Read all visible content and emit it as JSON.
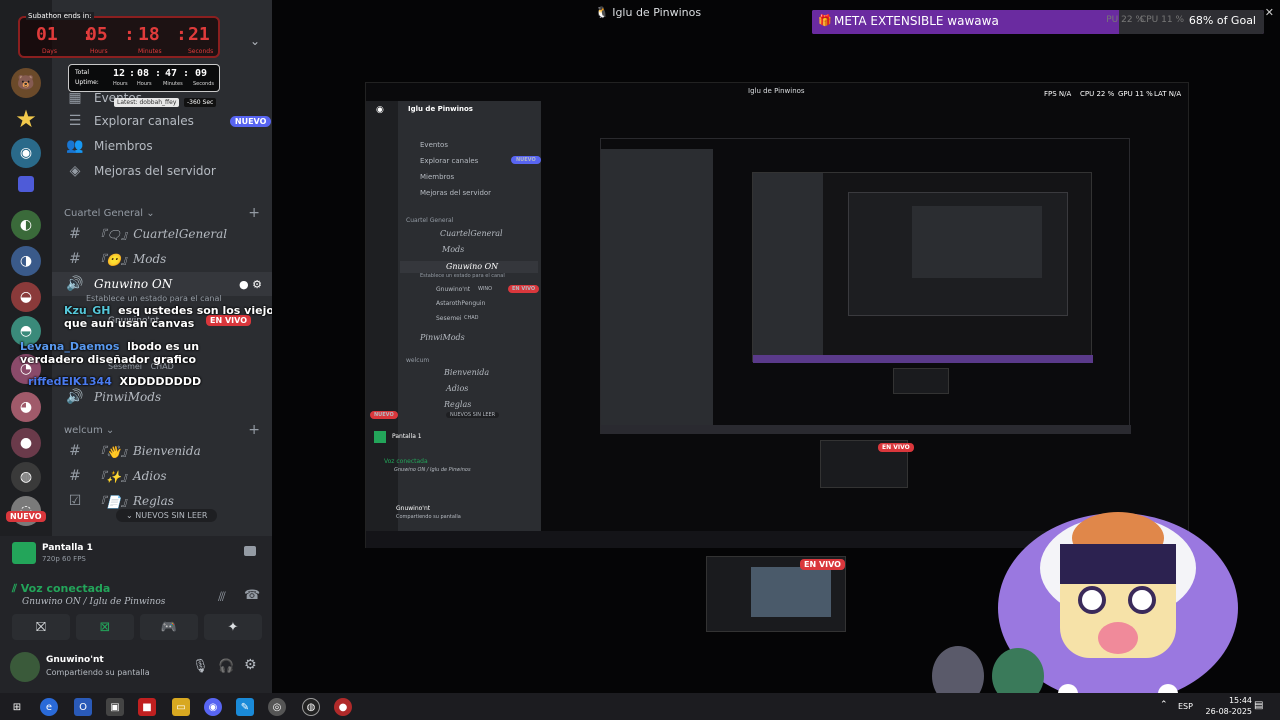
{
  "subathon": {
    "title": "Subathon ends in:",
    "days": "01",
    "hours": "05",
    "minutes": "18",
    "seconds": "21",
    "labels": [
      "Days",
      "Hours",
      "Minutes",
      "Seconds"
    ]
  },
  "uptime": {
    "total_label": "Total",
    "uptime_label": "Uptime:",
    "hours": "12",
    "minutes": "08",
    "seconds": "47",
    "extra": "09",
    "labels": [
      "Hours",
      "Hours",
      "Minutes",
      "Seconds"
    ],
    "latest": "Latest: dobbah_ffey",
    "latest_value": "-360 Sec"
  },
  "sidebar": {
    "events": "Eventos",
    "explore": "Explorar canales",
    "explore_badge": "NUEVO",
    "members": "Miembros",
    "server_improvements": "Mejoras del servidor",
    "category_general": "Cuartel General",
    "channels": [
      {
        "prefix": "『🗨』",
        "name": "CuartelGeneral"
      },
      {
        "prefix": "『😶』",
        "name": "Mods"
      }
    ],
    "voice_channel": {
      "name": "Gnuwino ON",
      "status": "Establece un estado para el canal"
    },
    "voice_users": [
      {
        "name": "Gnuwino'nt",
        "badge": "EN VIVO"
      },
      {
        "name": "Sesemei",
        "badge": "CHAD"
      }
    ],
    "voice_pinwi": "PinwiMods",
    "category_welcome": "welcum",
    "welcome_channels": [
      {
        "prefix": "『👋』",
        "name": "Bienvenida"
      },
      {
        "prefix": "『✨』",
        "name": "Adios"
      },
      {
        "prefix": "『📄』",
        "name": "Reglas"
      }
    ],
    "unread_pill": "NUEVOS SIN LEER",
    "nuevo_badge": "NUEVO"
  },
  "chat": [
    {
      "user": "Kzu_GH",
      "text": "esq ustedes son los viejos que aun usan canvas"
    },
    {
      "user": "Levana_Daemos",
      "text": "lbodo es un verdadero diseñador grafico"
    },
    {
      "user": "riffedElK1344",
      "text": "XDDDDDDDD"
    }
  ],
  "stream_panel": {
    "screen_name": "Pantalla 1",
    "screen_info": "720p 60 FPS",
    "voice_connected": "Voz conectada",
    "voice_location": "Gnuwino ON / Iglu de Pinwinos",
    "user_name": "Gnuwino'nt",
    "user_status": "Compartiendo su pantalla"
  },
  "window": {
    "title": "Iglu de Pinwinos"
  },
  "goal": {
    "label": "META EXTENSIBLE wawawa",
    "percent_text": "68% of Goal",
    "percent": 68
  },
  "stats_ghost": {
    "pu": "PU 22 %",
    "cpu": "CPU 11 %"
  },
  "nested": {
    "title": "Iglu de Pinwinos",
    "server": "Iglu de Pinwinos",
    "events": "Eventos",
    "explore": "Explorar canales",
    "badge": "NUEVO",
    "members": "Miembros",
    "improvements": "Mejoras del servidor",
    "category": "Cuartel General",
    "ch1": "CuartelGeneral",
    "ch2": "Mods",
    "voice": "Gnuwino ON",
    "voice_status": "Establece un estado para el canal",
    "u1": "Gnuwino'nt",
    "u1_tag": "WINO",
    "u1_badge": "EN VIVO",
    "u2": "AstarothPenguin",
    "u3": "Sesemei",
    "u3_tag": "CHAD",
    "pinwi": "PinwiMods",
    "welcome": "welcum",
    "w1": "Bienvenida",
    "w2": "Adios",
    "w3": "Reglas",
    "unread": "NUEVOS SIN LEER",
    "nuevo": "NUEVO",
    "screen": "Pantalla 1",
    "voice_conn": "Voz conectada",
    "voice_loc": "Gnuwino ON / Iglu de Pinwinos",
    "user": "Gnuwino'nt",
    "user_status": "Compartiendo su pantalla",
    "stats": {
      "fps": "FPS N/A",
      "cpu": "CPU 22 %",
      "gpu": "GPU 11 %",
      "lat": "LAT N/A"
    },
    "live_badge": "EN VIVO"
  },
  "live_badge_bottom": "EN VIVO",
  "clock": {
    "time": "15:44",
    "date": "26-08-2025",
    "lang": "ESP"
  }
}
